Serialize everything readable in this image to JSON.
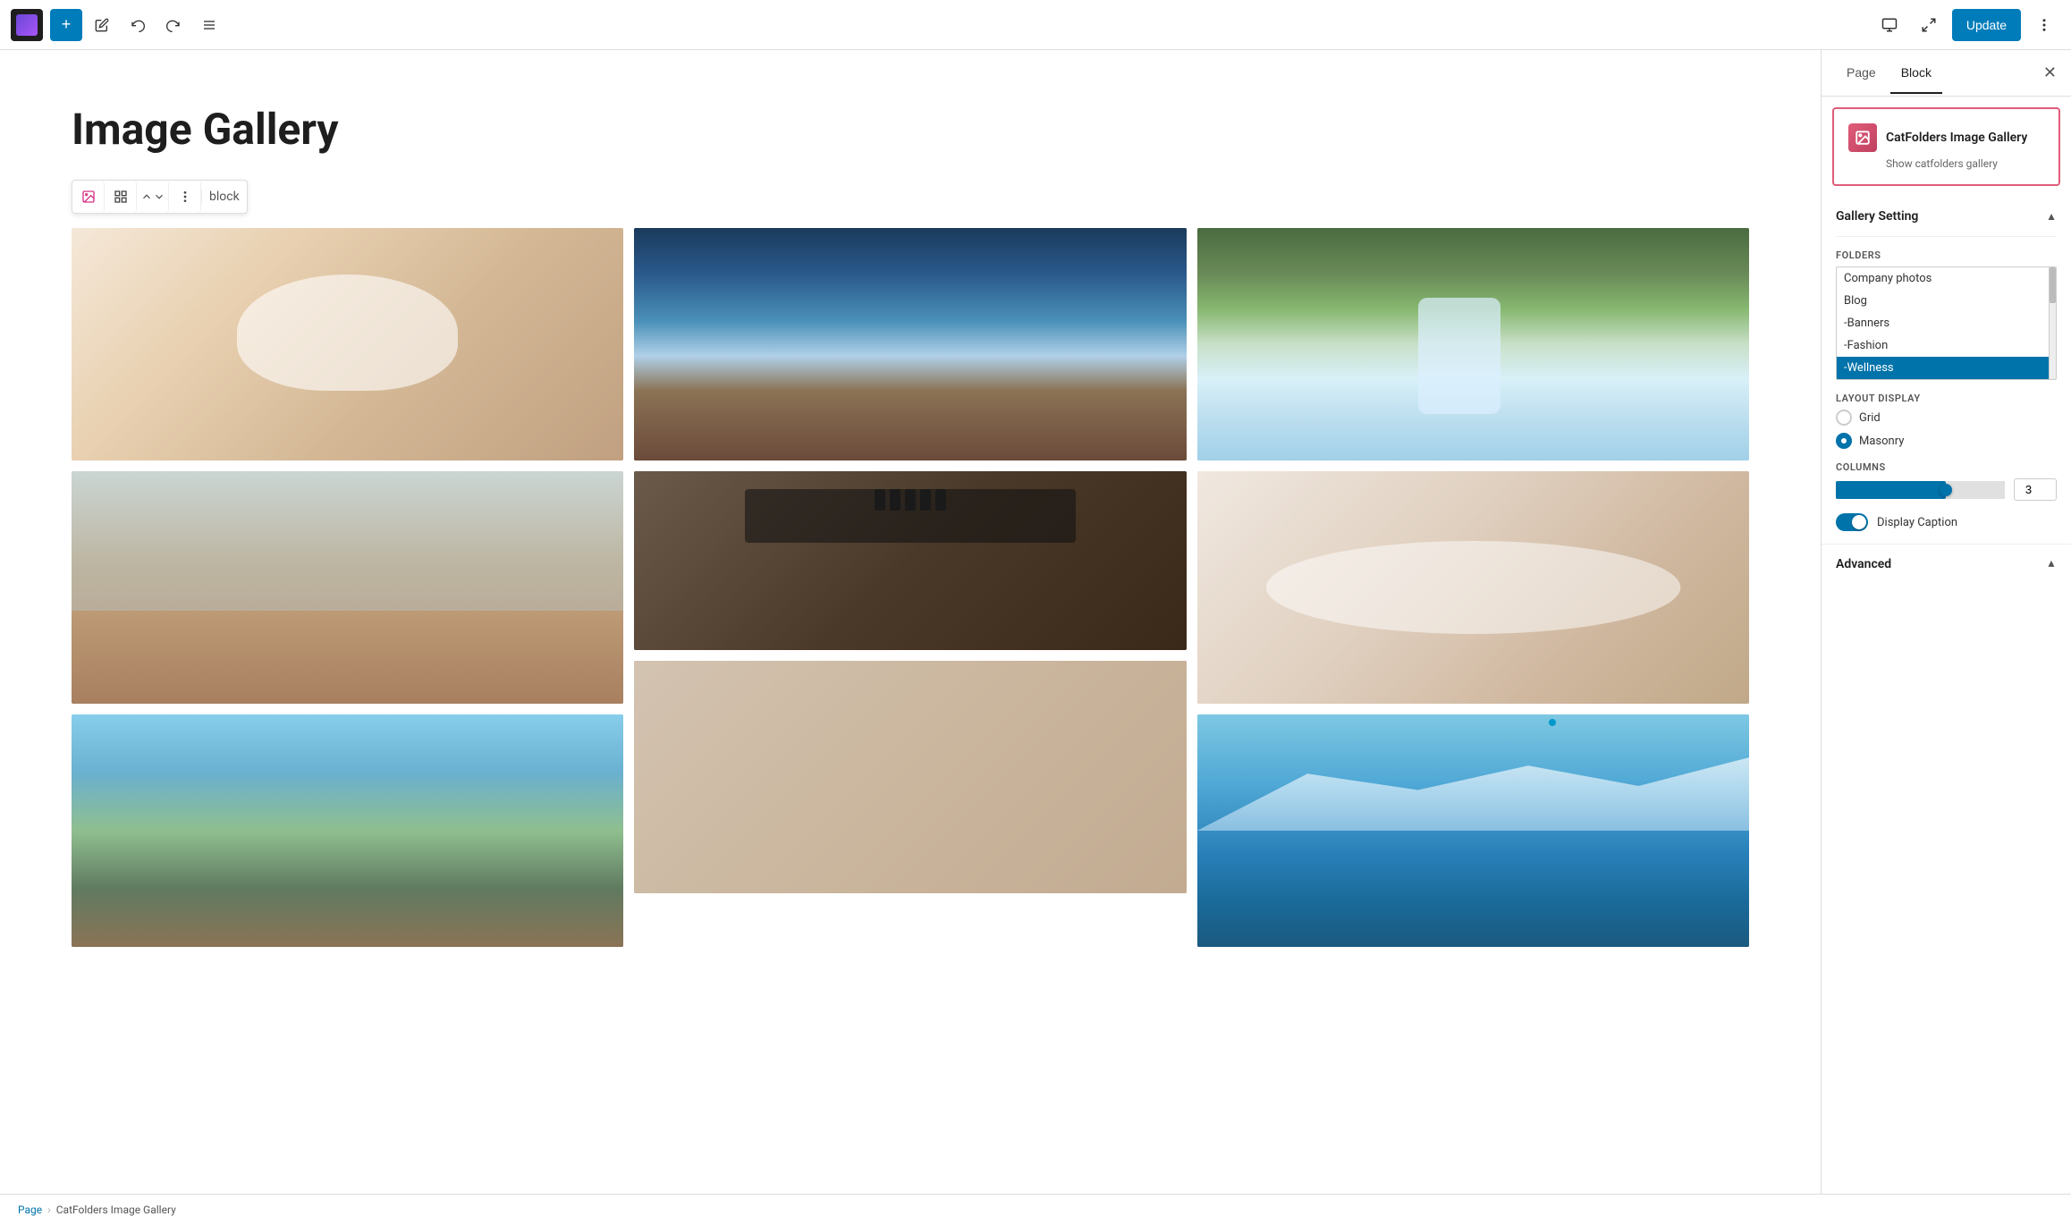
{
  "app": {
    "title": "Image Gallery"
  },
  "toolbar": {
    "add_label": "+",
    "undo_label": "↩",
    "redo_label": "↪",
    "list_label": "≡",
    "update_label": "Update"
  },
  "block_toolbar": {
    "block_label": "block"
  },
  "sidebar": {
    "tab_page": "Page",
    "tab_block": "Block",
    "plugin_name": "CatFolders Image Gallery",
    "plugin_desc": "Show catfolders gallery"
  },
  "gallery_setting": {
    "title": "Gallery Setting",
    "folders_label": "FOLDERS",
    "folders": [
      {
        "name": "Company photos",
        "selected": false
      },
      {
        "name": "Blog",
        "selected": false
      },
      {
        "name": "-Banners",
        "selected": false
      },
      {
        "name": "-Fashion",
        "selected": false
      },
      {
        "name": "-Wellness",
        "selected": true
      }
    ],
    "layout_label": "LAYOUT DISPLAY",
    "layout_grid": "Grid",
    "layout_masonry": "Masonry",
    "layout_selected": "masonry",
    "columns_label": "COLUMNS",
    "columns_value": "3",
    "columns_slider_pct": 65,
    "display_caption_label": "Display Caption",
    "advanced_label": "Advanced"
  },
  "breadcrumb": {
    "page": "Page",
    "separator": "›",
    "current": "CatFolders Image Gallery"
  }
}
